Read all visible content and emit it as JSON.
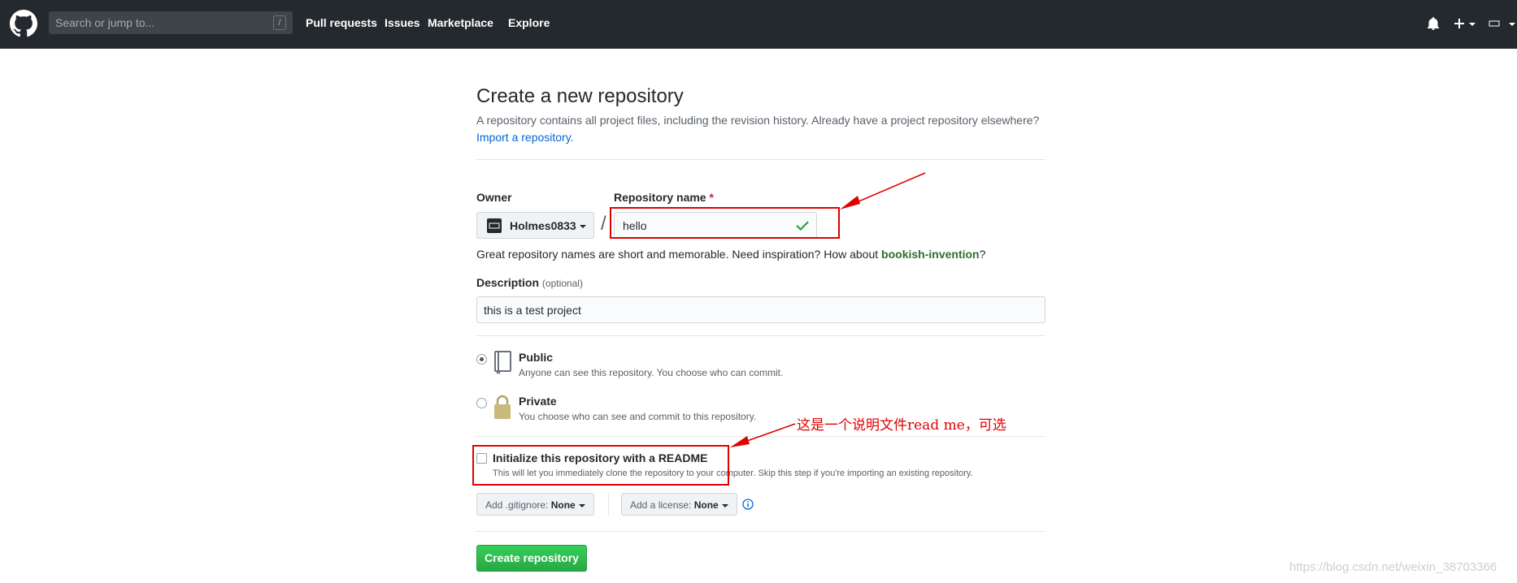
{
  "header": {
    "search_placeholder": "Search or jump to...",
    "search_shortcut": "/",
    "nav": [
      "Pull requests",
      "Issues",
      "Marketplace",
      "Explore"
    ],
    "icons": [
      "github-logo-icon",
      "bell-icon",
      "plus-icon",
      "user-avatar-icon"
    ]
  },
  "page": {
    "title": "Create a new repository",
    "subtitle": "A repository contains all project files, including the revision history. Already have a project repository elsewhere?",
    "import_link": "Import a repository",
    "import_suffix": "."
  },
  "form": {
    "owner_label": "Owner",
    "owner_value": "Holmes0833",
    "slash": "/",
    "repo_label": "Repository name",
    "required_mark": "*",
    "repo_value": "hello",
    "hint_prefix": "Great repository names are short and memorable. Need inspiration? How about ",
    "hint_suggestion": "bookish-invention",
    "hint_suffix": "?",
    "desc_label": "Description",
    "desc_optional": "(optional)",
    "desc_value": "this is a test project",
    "visibility": [
      {
        "title": "Public",
        "note": "Anyone can see this repository. You choose who can commit.",
        "selected": true
      },
      {
        "title": "Private",
        "note": "You choose who can see and commit to this repository.",
        "selected": false
      }
    ],
    "readme_title": "Initialize this repository with a README",
    "readme_note": "This will let you immediately clone the repository to your computer. Skip this step if you're importing an existing repository.",
    "gitignore_label": "Add .gitignore:",
    "gitignore_value": "None",
    "license_label": "Add a license:",
    "license_value": "None",
    "create_button": "Create repository"
  },
  "annotation": {
    "text": "这是一个说明文件read me，可选",
    "color": "#e00000"
  },
  "watermark": "https://blog.csdn.net/weixin_38703366"
}
